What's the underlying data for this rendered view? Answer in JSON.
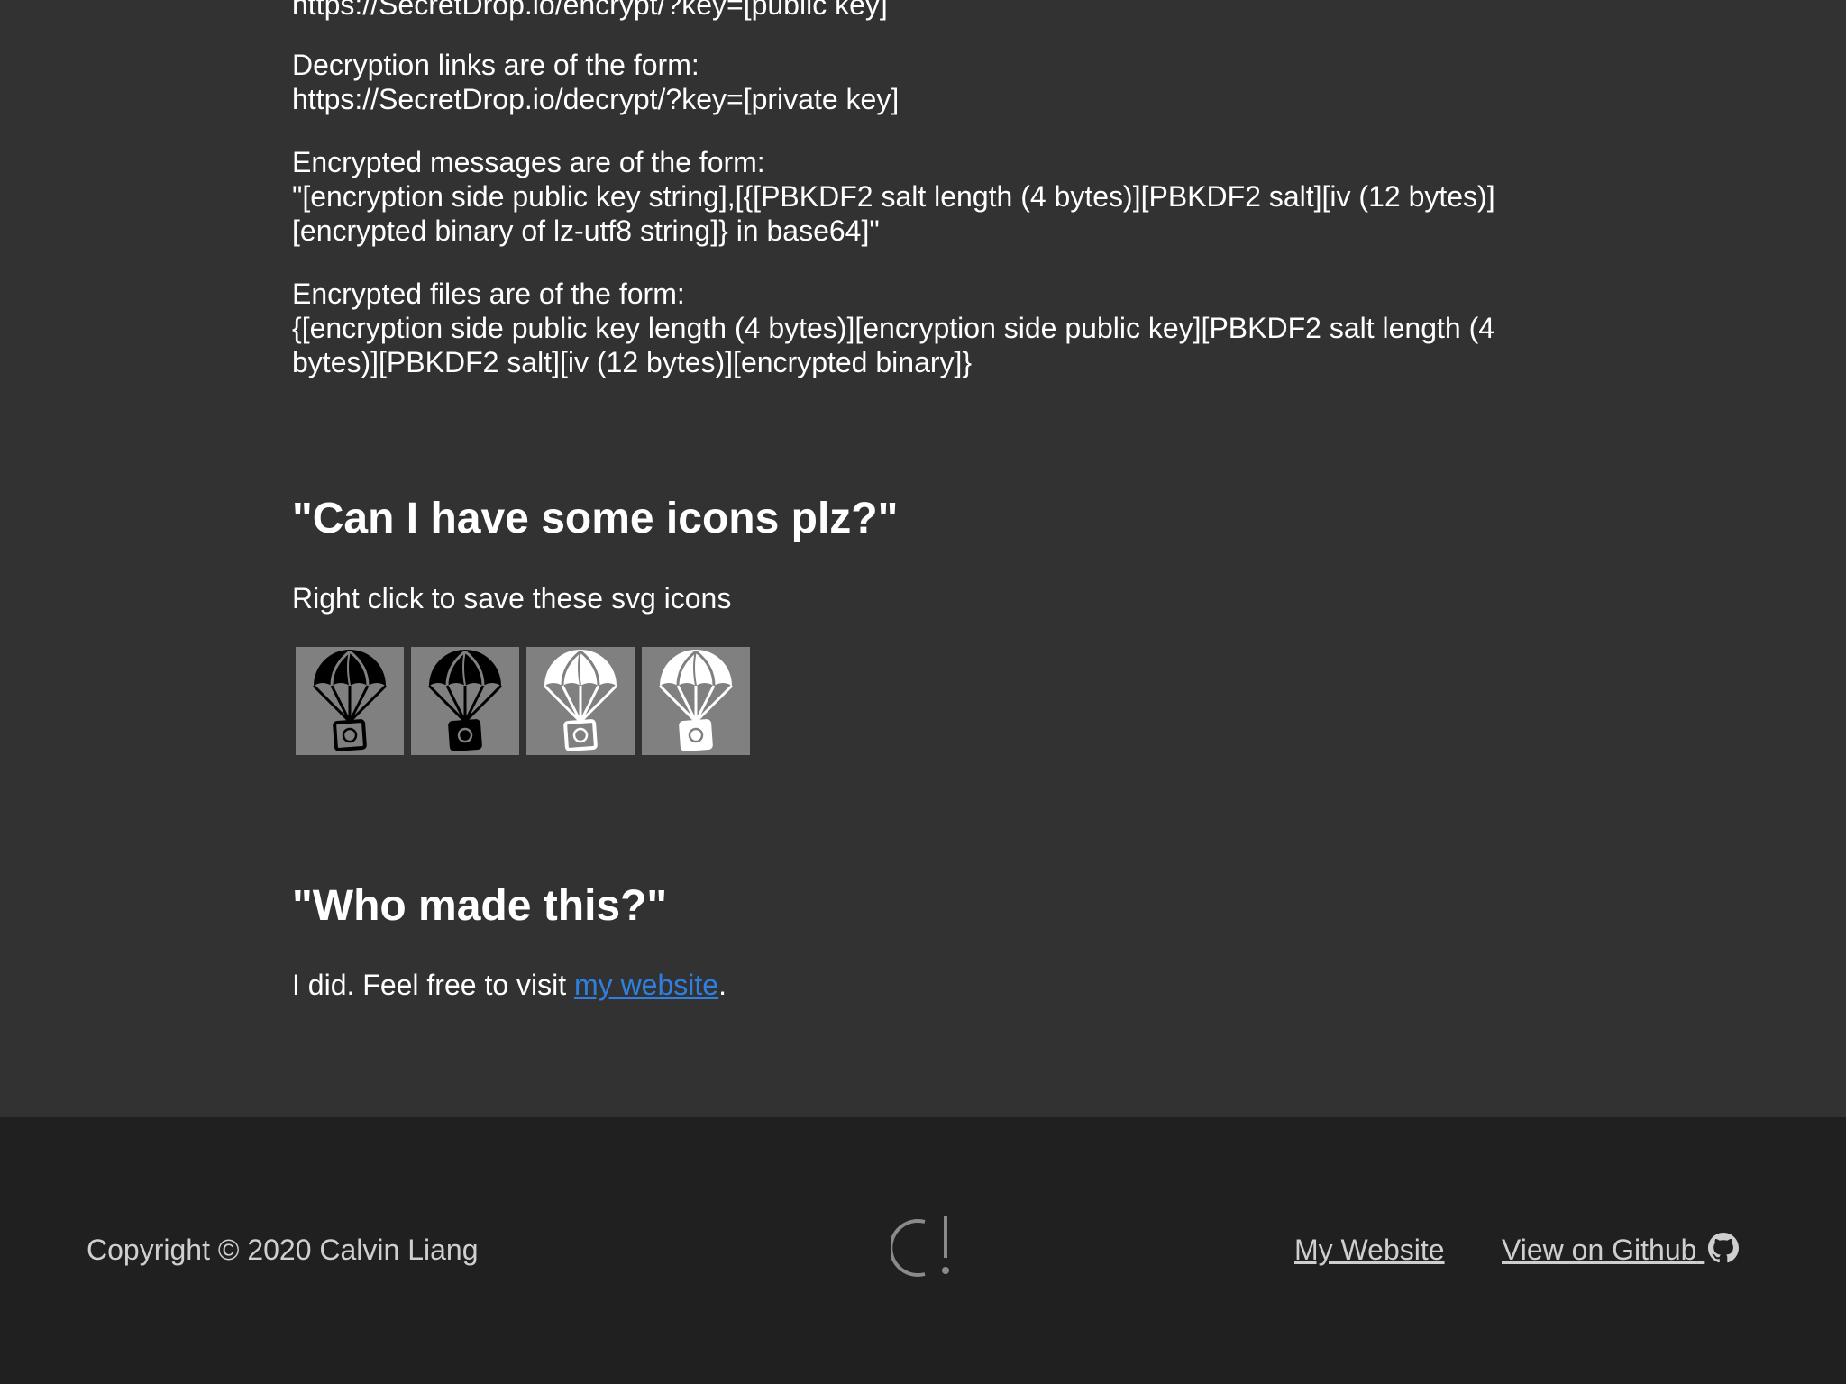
{
  "format_section": {
    "encrypt_link_line": "https://SecretDrop.io/encrypt/?key=[public key]",
    "decrypt_intro": "Decryption links are of the form:",
    "decrypt_link_line": "https://SecretDrop.io/decrypt/?key=[private key]",
    "messages_intro": "Encrypted messages are of the form:",
    "messages_line1": "\"[encryption side public key string],[{[PBKDF2 salt length (4 bytes)][PBKDF2 salt][iv (12 bytes)]",
    "messages_line2": "[encrypted binary of lz-utf8 string]} in base64]\"",
    "files_intro": "Encrypted files are of the form:",
    "files_line1": "{[encryption side public key length (4 bytes)][encryption side public key][PBKDF2 salt length (4",
    "files_line2": "bytes)][PBKDF2 salt][iv (12 bytes)][encrypted binary]}"
  },
  "icons_section": {
    "heading": "\"Can I have some icons plz?\"",
    "description": "Right click to save these svg icons",
    "icons": [
      {
        "name": "parachute-icon-black-outline",
        "canopy": "#000000",
        "box": "#808080",
        "box_stroke": "#000000"
      },
      {
        "name": "parachute-icon-black-filled",
        "canopy": "#000000",
        "box": "#000000",
        "box_stroke": "#000000"
      },
      {
        "name": "parachute-icon-white-outline",
        "canopy": "#ffffff",
        "box": "#808080",
        "box_stroke": "#ffffff"
      },
      {
        "name": "parachute-icon-white-filled",
        "canopy": "#ffffff",
        "box": "#ffffff",
        "box_stroke": "#ffffff"
      }
    ]
  },
  "about_section": {
    "heading": "\"Who made this?\"",
    "text_before": "I did. Feel free to visit ",
    "link_text": "my website",
    "text_after": "."
  },
  "footer": {
    "copyright": "Copyright © 2020 Calvin Liang",
    "my_website_label": "My Website",
    "github_label": "View on Github"
  },
  "colors": {
    "background": "#323232",
    "footer_background": "#202020",
    "link": "#2f7fe0",
    "footer_text": "#cfcfcf",
    "icon_tile": "#808080"
  }
}
